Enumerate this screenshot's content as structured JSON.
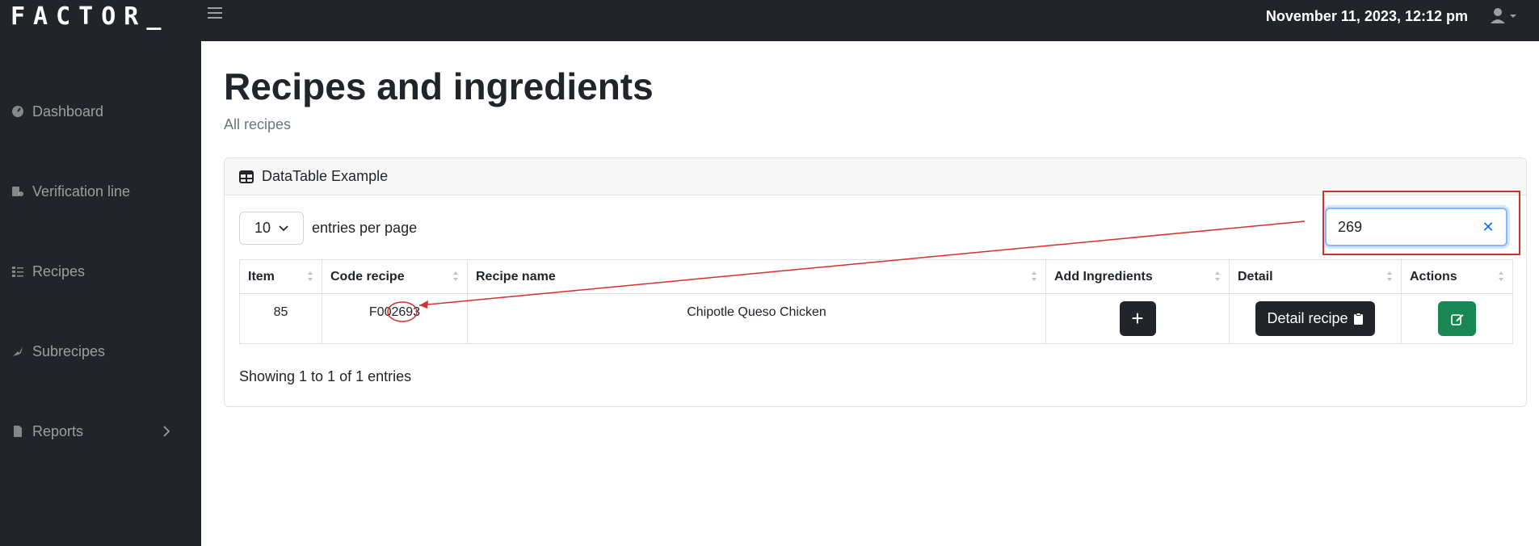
{
  "app": {
    "brand": "FACTOR_",
    "datetime": "November 11, 2023, 12:12 pm"
  },
  "sidebar": {
    "items": [
      {
        "label": "Dashboard",
        "icon": "dashboard-icon"
      },
      {
        "label": "Verification line",
        "icon": "verification-icon"
      },
      {
        "label": "Recipes",
        "icon": "recipes-icon"
      },
      {
        "label": "Subrecipes",
        "icon": "subrecipes-icon"
      },
      {
        "label": "Reports",
        "icon": "reports-icon"
      }
    ]
  },
  "page": {
    "title": "Recipes and ingredients",
    "subtitle": "All recipes"
  },
  "card": {
    "header": "DataTable Example",
    "entries_value": "10",
    "entries_label": "entries per page",
    "search_value": "269",
    "columns": [
      "Item",
      "Code recipe",
      "Recipe name",
      "Add Ingredients",
      "Detail",
      "Actions"
    ],
    "rows": [
      {
        "item": "85",
        "code": "F002693",
        "name": "Chipotle Queso Chicken",
        "add_label": "+",
        "detail_label": "Detail recipe"
      }
    ],
    "footer": "Showing 1 to 1 of 1 entries"
  },
  "colors": {
    "navbar": "#212529",
    "annotation": "#d32f2f",
    "edit_button": "#198754"
  }
}
